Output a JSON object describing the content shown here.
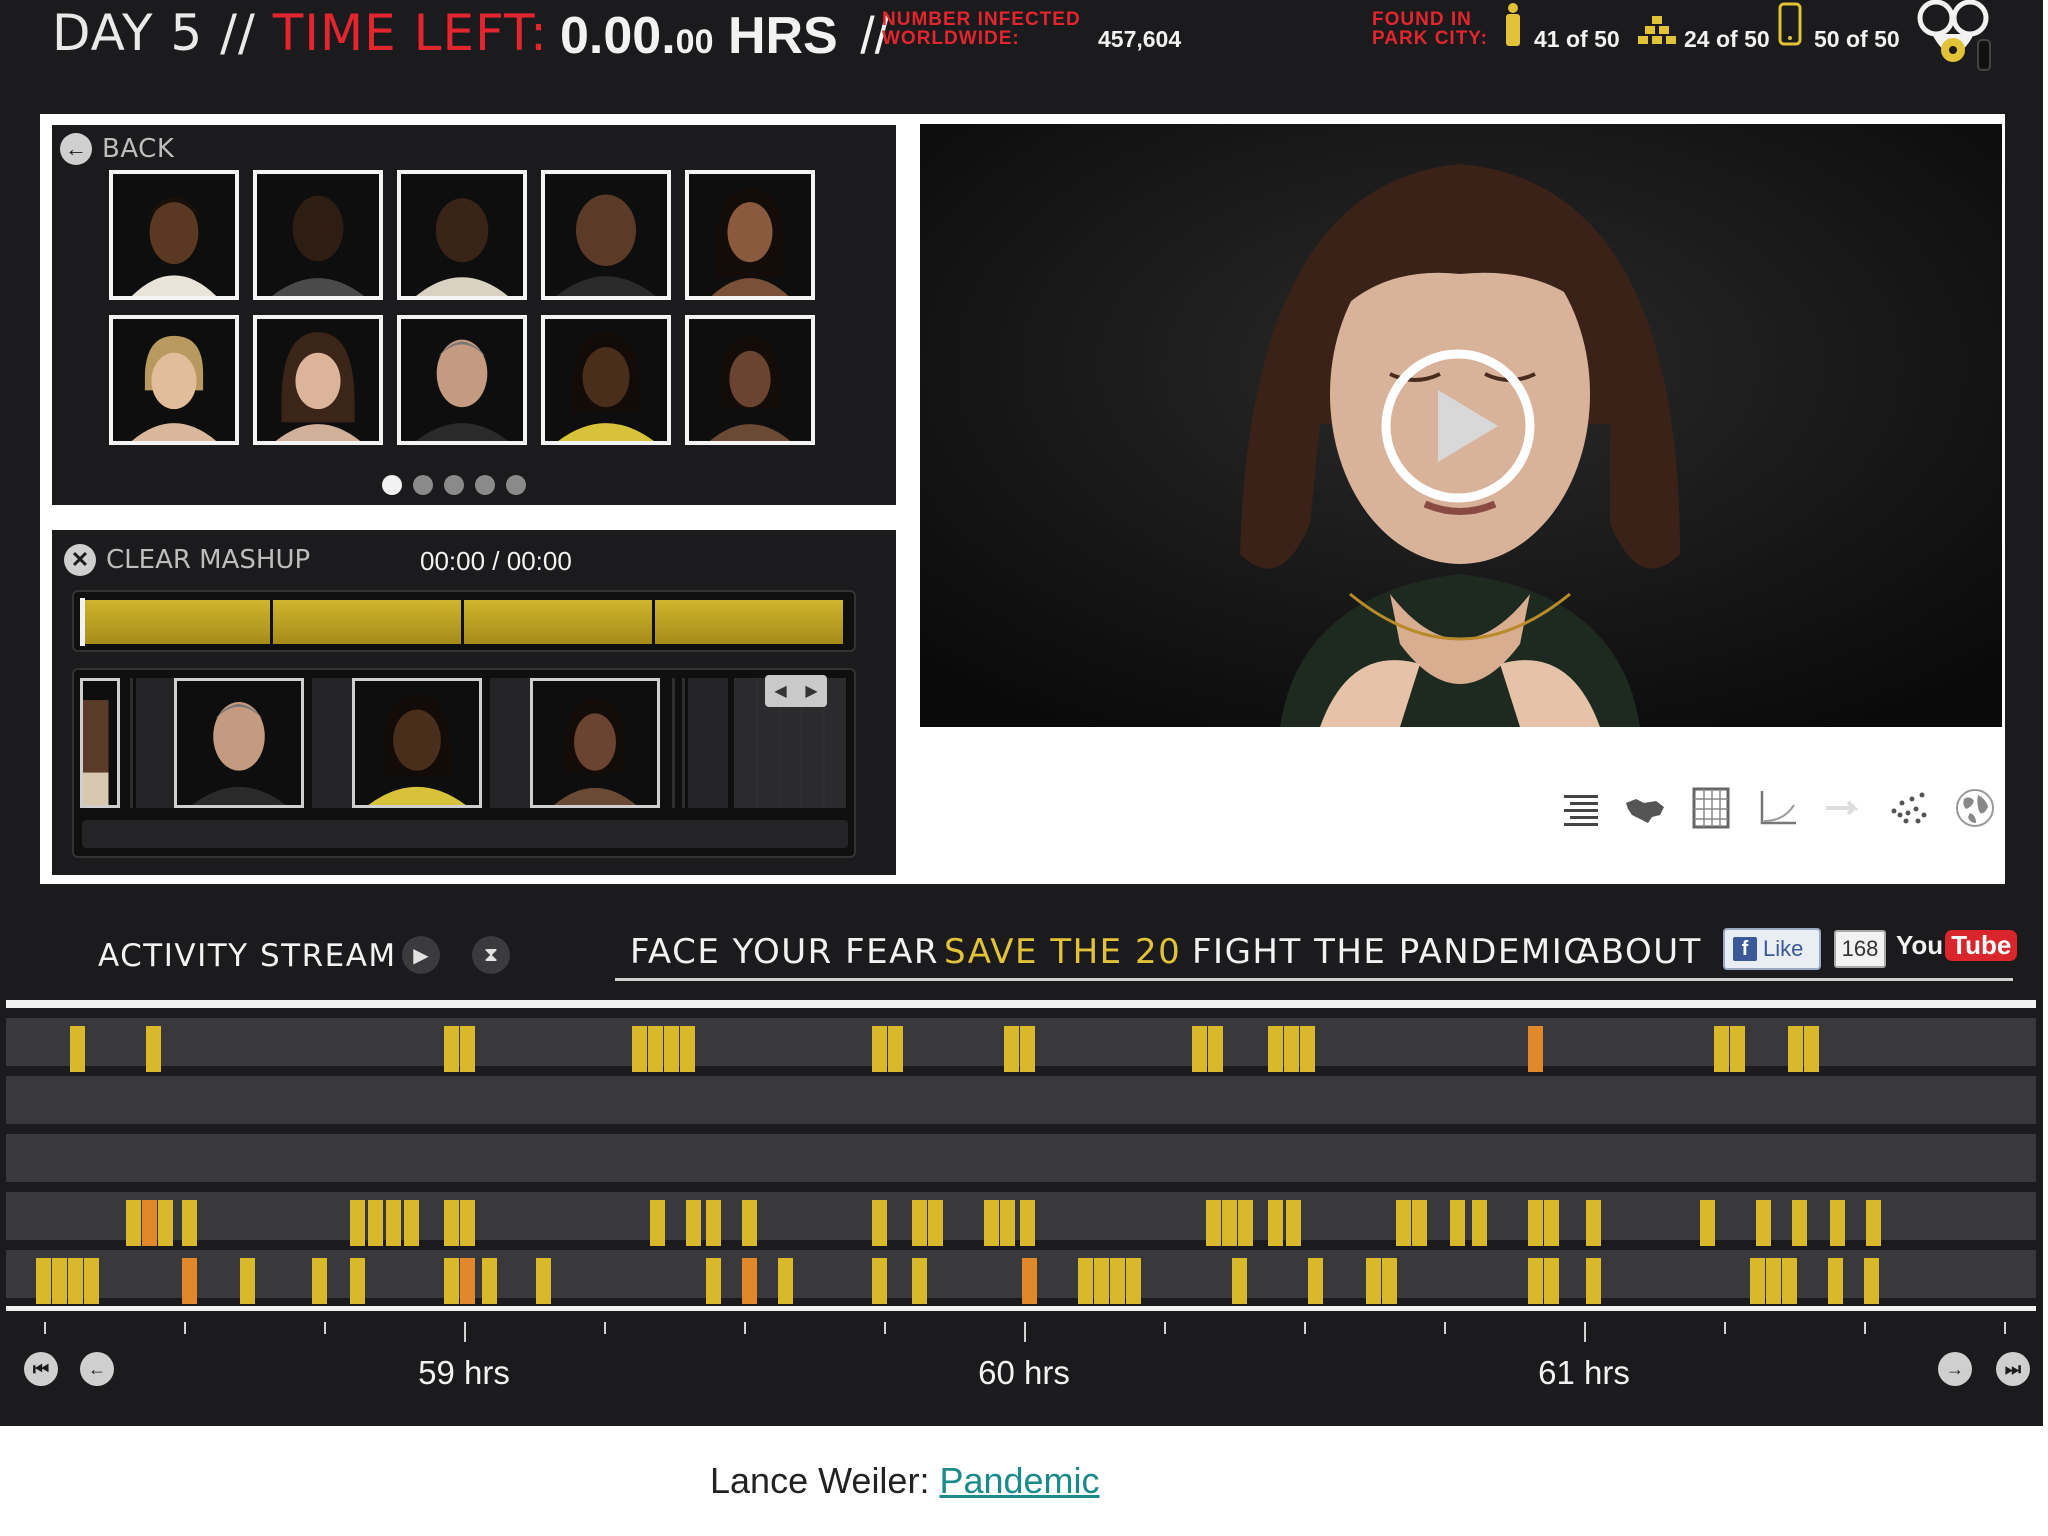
{
  "header": {
    "day": "DAY 5",
    "separator": "//",
    "time_left_label": "TIME LEFT:",
    "time_main": "0.00.",
    "time_small": "00",
    "time_unit": "HRS",
    "time_separator": "//",
    "infected_label_line1": "NUMBER INFECTED",
    "infected_label_line2": "WORLDWIDE:",
    "infected_count": "457,604",
    "found_label_line1": "FOUND IN",
    "found_label_line2": "PARK CITY:",
    "found_counts": [
      {
        "icon": "figure-icon",
        "text": "41 of 50"
      },
      {
        "icon": "stacked-bars-icon",
        "text": "24 of 50"
      },
      {
        "icon": "phone-icon",
        "text": "50 of 50"
      }
    ],
    "gasmask_icon": "gas-mask-icon"
  },
  "faces_panel": {
    "back_label": "BACK",
    "page_count": 5,
    "active_page": 0
  },
  "mashup": {
    "clear_label": "CLEAR MASHUP",
    "time": "00:00 / 00:00"
  },
  "nav": {
    "activity_stream": "ACTIVITY STREAM",
    "items": [
      {
        "label": "FACE YOUR FEAR",
        "active": false
      },
      {
        "label": "SAVE THE 20",
        "active": true
      },
      {
        "label": "FIGHT THE PANDEMIC",
        "active": false
      },
      {
        "label": "ABOUT",
        "active": false
      }
    ],
    "fb_like": "Like",
    "fb_count": "168",
    "youtube_you": "You",
    "youtube_tube": "Tube"
  },
  "timeline": {
    "hour_labels": [
      "59 hrs",
      "60 hrs",
      "61 hrs"
    ]
  },
  "colors": {
    "accent_yellow": "#e2c237",
    "event_yellow": "#d9b929",
    "event_orange": "#e0882a",
    "alert_red": "#e3252e"
  },
  "caption": {
    "prefix": "Lance Weiler: ",
    "link": "Pandemic"
  }
}
